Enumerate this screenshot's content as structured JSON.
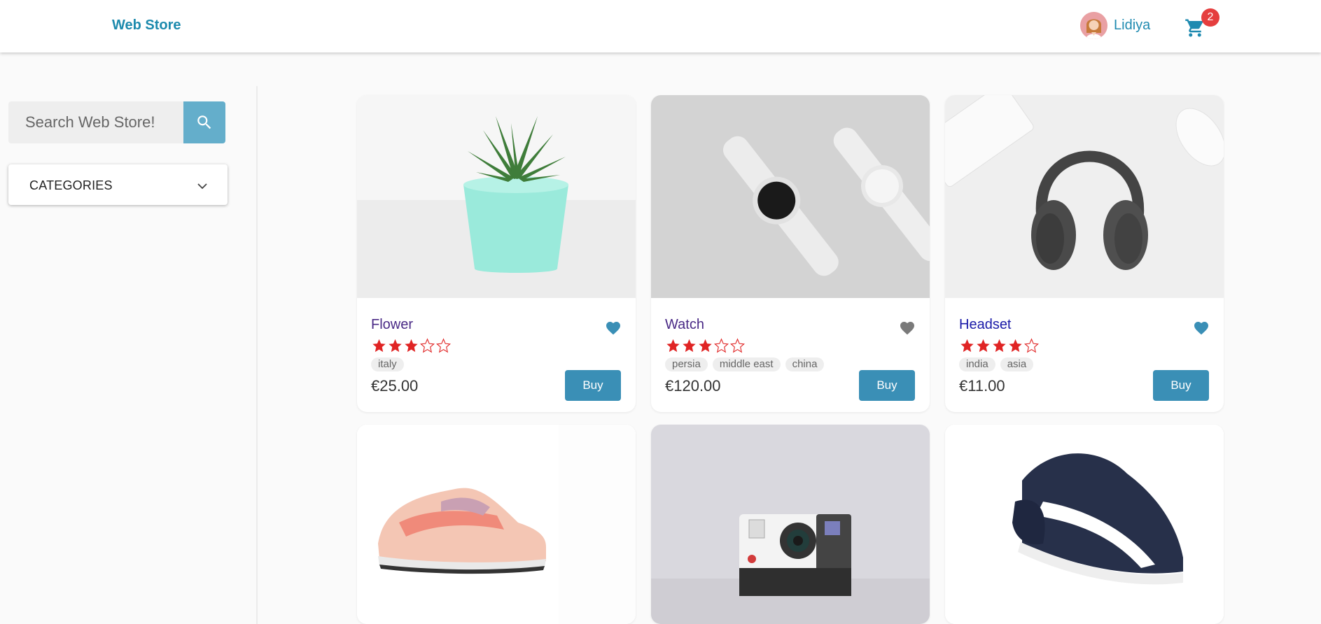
{
  "header": {
    "brand": "Web Store",
    "user_name": "Lidiya",
    "cart_count": "2"
  },
  "sidebar": {
    "search_placeholder": "Search Web Store!",
    "categories_label": "CATEGORIES"
  },
  "products": [
    {
      "name": "Flower",
      "name_color": "#4a2a86",
      "rating": 3,
      "max_rating": 5,
      "tags": [
        "italy"
      ],
      "price": "€25.00",
      "buy": "Buy",
      "favorite": true
    },
    {
      "name": "Watch",
      "name_color": "#4a2a86",
      "rating": 3,
      "max_rating": 5,
      "tags": [
        "persia",
        "middle east",
        "china"
      ],
      "price": "€120.00",
      "buy": "Buy",
      "favorite": false
    },
    {
      "name": "Headset",
      "name_color": "#1a1aa8",
      "rating": 4,
      "max_rating": 5,
      "tags": [
        "india",
        "asia"
      ],
      "price": "€11.00",
      "buy": "Buy",
      "favorite": true
    },
    {
      "image": "sneaker-pink"
    },
    {
      "image": "instant-camera"
    },
    {
      "image": "sneaker-navy"
    }
  ],
  "colors": {
    "accent": "#3a8fb6",
    "heart_favorite": "#3a8fb6",
    "heart_default": "#7a7a7a",
    "star": "#e02424",
    "badge": "#e53e3e"
  },
  "icons": {
    "search": "search-icon",
    "cart": "cart-icon",
    "heart": "heart-icon",
    "chevron": "chevron-down-icon",
    "star": "star-icon"
  }
}
